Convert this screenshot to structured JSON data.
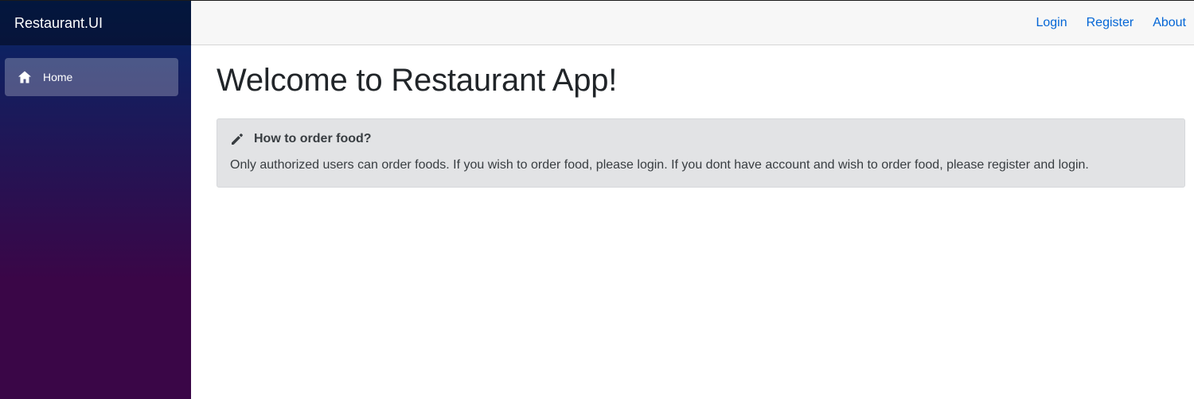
{
  "sidebar": {
    "brand": "Restaurant.UI",
    "items": [
      {
        "label": "Home",
        "icon": "home-icon",
        "active": true
      }
    ]
  },
  "topbar": {
    "links": [
      {
        "label": "Login"
      },
      {
        "label": "Register"
      },
      {
        "label": "About"
      }
    ]
  },
  "main": {
    "title": "Welcome to Restaurant App!",
    "alert": {
      "icon": "pencil-icon",
      "title": "How to order food?",
      "body": "Only authorized users can order foods. If you wish to order food, please login. If you dont have account and wish to order food, please register and login."
    }
  },
  "colors": {
    "link": "#0366d6",
    "sidebar_top": "#052767",
    "sidebar_bottom": "#3a0647",
    "alert_bg": "#e2e3e5"
  }
}
